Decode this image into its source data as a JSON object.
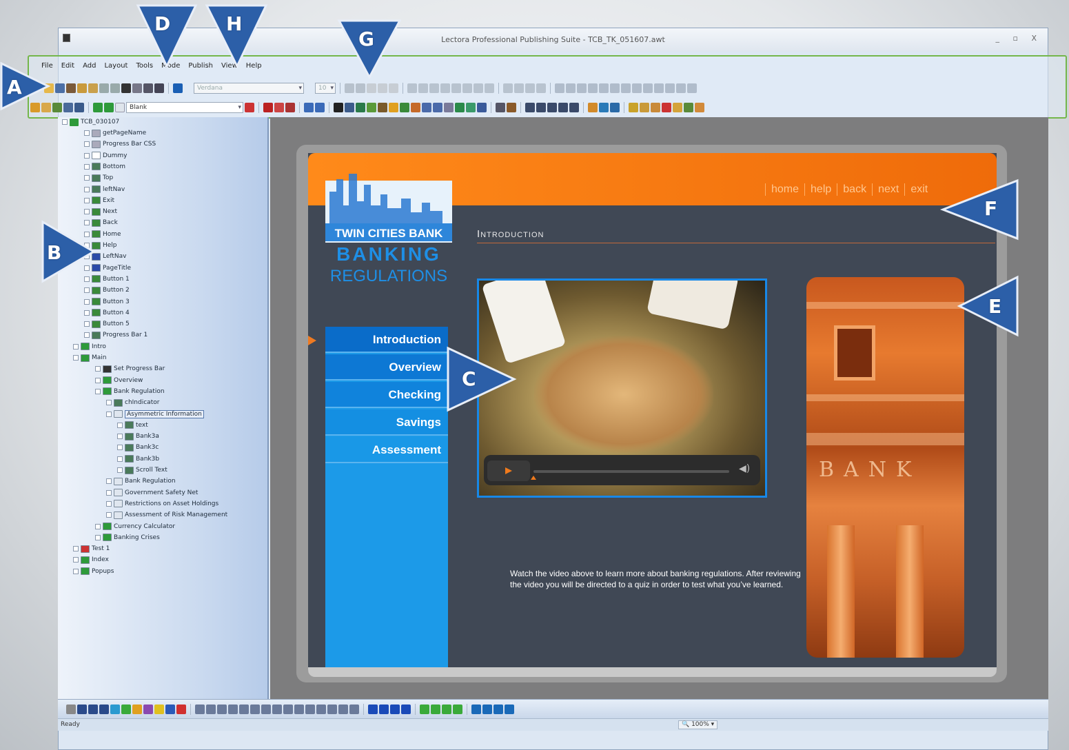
{
  "window": {
    "title": "Lectora Professional Publishing Suite - TCB_TK_051607.awt",
    "controls": "_ ▫ X"
  },
  "menu": [
    "File",
    "Edit",
    "Add",
    "Layout",
    "Tools",
    "Mode",
    "Publish",
    "View",
    "Help"
  ],
  "toolbar": {
    "font_name": "Verdana",
    "font_size": "10",
    "page_type": "Blank"
  },
  "tree": {
    "root": "TCB_030107",
    "items": [
      "getPageName",
      "Progress Bar CSS",
      "Dummy",
      "Bottom",
      "Top",
      "leftNav",
      "Exit",
      "Next",
      "Back",
      "Home",
      "Help",
      "LeftNav",
      "PageTitle",
      "Button 1",
      "Button 2",
      "Button 3",
      "Button 4",
      "Button 5",
      "Progress Bar 1",
      "Intro",
      "Main",
      "Set Progress Bar",
      "Overview",
      "Bank Regulation",
      "chIndicator",
      "Asymmetric Information",
      "text",
      "Bank3a",
      "Bank3c",
      "Bank3b",
      "Scroll Text",
      "Bank Regulation",
      "Government Safety Net",
      "Restrictions on Asset Holdings",
      "Assessment of Risk Management",
      "Currency Calculator",
      "Banking Crises",
      "Test 1",
      "Index",
      "Popups"
    ]
  },
  "course": {
    "logo_top": "TWIN CITIES BANK",
    "logo_mid": "BANKING",
    "logo_bottom": "REGULATIONS",
    "top_nav": [
      "home",
      "help",
      "back",
      "next",
      "exit"
    ],
    "page_heading": "Introduction",
    "left_nav": [
      "Introduction",
      "Overview",
      "Checking",
      "Savings",
      "Assessment"
    ],
    "caption": "Watch the video above to learn more about banking regulations. After reviewing the video you will be directed to a quiz in order to test what you’ve learned.",
    "building_text": "BANK"
  },
  "status": {
    "text": "Ready",
    "zoom": "100%"
  },
  "callouts": [
    "A",
    "B",
    "C",
    "D",
    "E",
    "F",
    "G",
    "H"
  ],
  "colors": {
    "accent_orange": "#f07a1c",
    "nav_blue": "#1c9ae8",
    "callout_blue": "#2c5fa8",
    "highlight_green": "#74b64a"
  }
}
